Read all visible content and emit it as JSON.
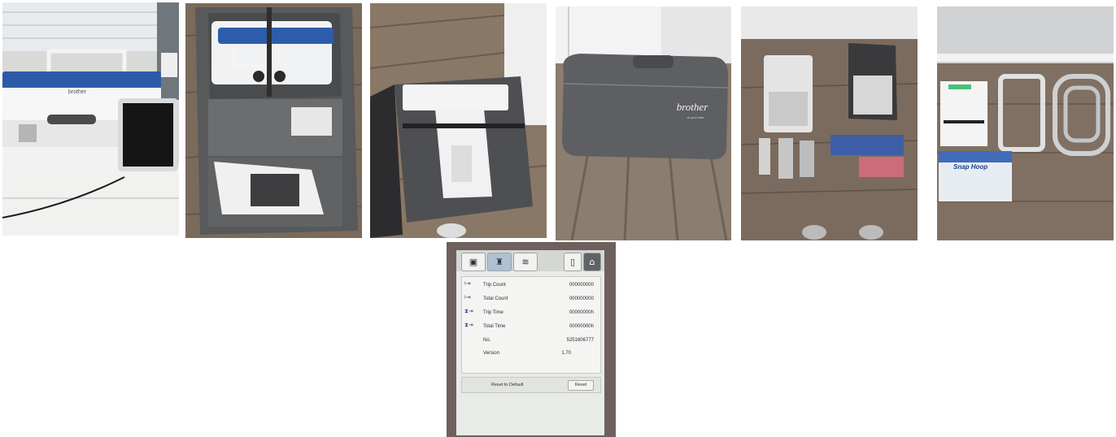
{
  "lcd": {
    "tabs": [
      {
        "icon": "machine-icon",
        "glyph": "▣"
      },
      {
        "icon": "sewing-settings-icon",
        "glyph": "♜"
      },
      {
        "icon": "wifi-icon",
        "glyph": "≋"
      },
      {
        "icon": "embroidery-frame-icon",
        "glyph": "▯"
      },
      {
        "icon": "home-icon",
        "glyph": "⌂"
      }
    ],
    "rows": [
      {
        "icon": "needle-count-icon",
        "label": "Trip Count",
        "value": "000000000"
      },
      {
        "icon": "needle-count-icon",
        "label": "Total Count",
        "value": "000000000"
      },
      {
        "icon": "hourglass-icon",
        "label": "Trip Time",
        "value": "00000000h"
      },
      {
        "icon": "hourglass-icon",
        "label": "Total Time",
        "value": "00000000h"
      },
      {
        "icon": "",
        "label": "No.",
        "value": "5251606777"
      },
      {
        "icon": "",
        "label": "Version",
        "value": "1.70"
      }
    ],
    "reset_to_default_label": "Reset to Default",
    "reset_button": "Reset"
  },
  "photo_text": {
    "machine_brand": "brother",
    "case_brand": "brother",
    "case_tagline": "at your side",
    "box_title": "Snap Hoop"
  }
}
